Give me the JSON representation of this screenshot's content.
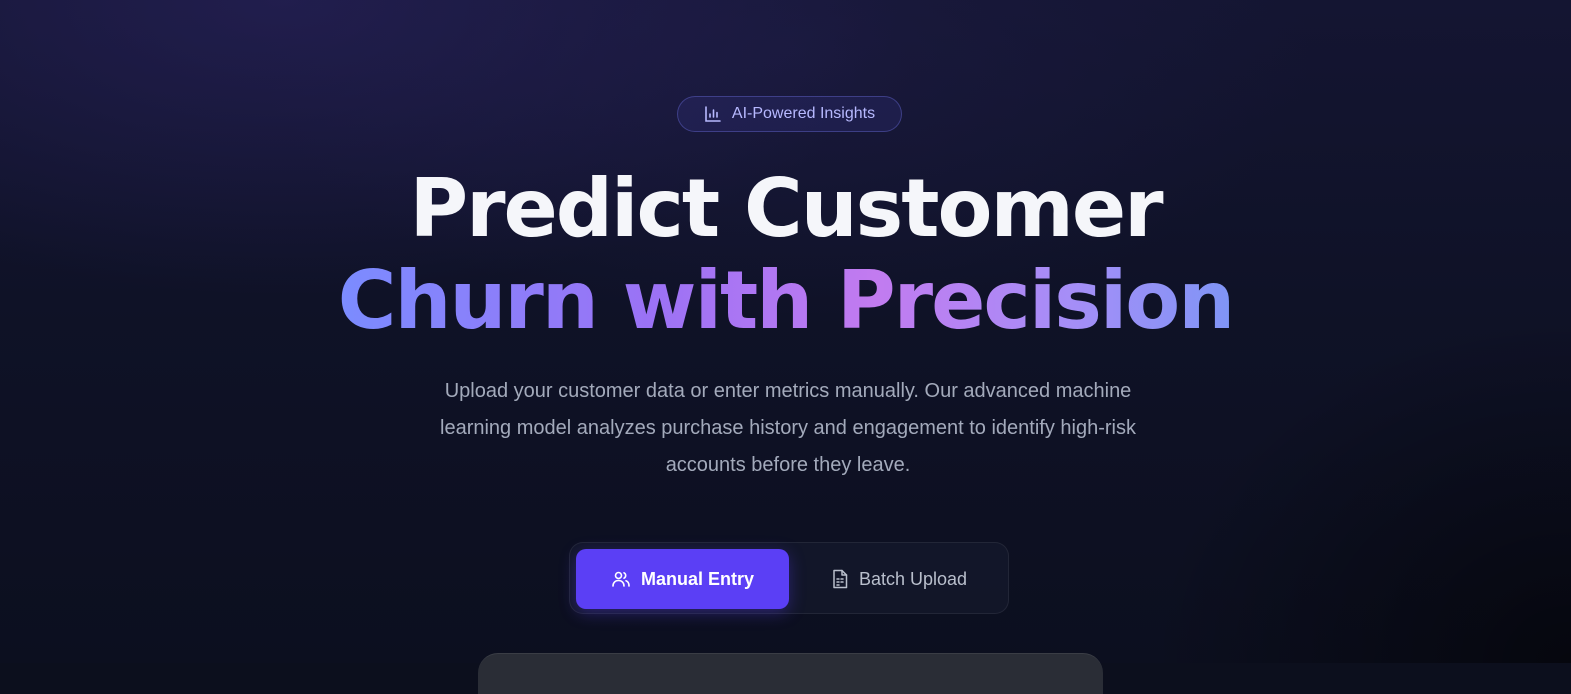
{
  "badge": {
    "icon": "bar-chart-icon",
    "label": "AI-Powered Insights"
  },
  "hero": {
    "title_line1": "Predict Customer",
    "title_line2": "Churn with Precision",
    "subtitle_line1": "Upload your customer data or enter metrics manually. Our advanced machine",
    "subtitle_line2": "learning model analyzes purchase history and engagement to identify high-risk",
    "subtitle_line3": "accounts before they leave."
  },
  "mode_toggle": {
    "options": [
      {
        "label": "Manual Entry",
        "icon": "users-icon",
        "active": true
      },
      {
        "label": "Batch Upload",
        "icon": "file-sheet-icon",
        "active": false
      }
    ]
  },
  "colors": {
    "accent": "#5b3ff5",
    "badge_text": "#b7b9ff",
    "gradient_start": "#7b8cff",
    "gradient_mid": "#c27bf0",
    "background": "#0c0f1d"
  }
}
